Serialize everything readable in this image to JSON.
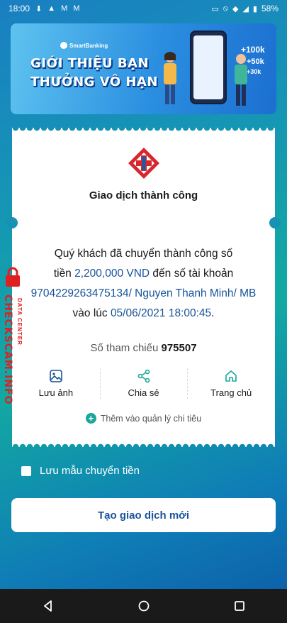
{
  "status_bar": {
    "time": "18:00",
    "battery": "58%"
  },
  "banner": {
    "brand": "SmartBanking",
    "headline_line1": "GIỚI THIỆU BẠN",
    "headline_line2": "THƯỞNG VÔ HẠN",
    "bonus_1": "+100k",
    "bonus_2": "+50k",
    "bonus_3": "+30k"
  },
  "receipt": {
    "title": "Giao dịch thành công",
    "msg_line1": "Quý khách đã chuyển thành công số",
    "msg_prefix2": "tiền ",
    "amount": "2,200,000 VND",
    "msg_mid2": " đến số tài khoản",
    "recipient": "9704229263475134/ Nguyen Thanh Minh/ MB",
    "msg_prefix4": "vào lúc ",
    "datetime": "05/06/2021 18:00:45",
    "msg_suffix4": ".",
    "ref_label": "Số tham chiếu",
    "ref_number": "975507",
    "actions": [
      {
        "label": "Lưu ảnh",
        "icon": "image-icon"
      },
      {
        "label": "Chia sẻ",
        "icon": "share-icon"
      },
      {
        "label": "Trang chủ",
        "icon": "home-icon"
      }
    ],
    "add_expense": "Thêm vào quản lý chi tiêu"
  },
  "save_template": {
    "label": "Lưu mẫu chuyển tiền",
    "checked": false
  },
  "new_transaction_button": "Tạo giao dịch mới",
  "watermark": {
    "main": "CHECKSCAM.INFO",
    "sub": "DATA CENTER"
  },
  "colors": {
    "accent": "#17539a",
    "teal": "#1aa69b",
    "logo_red": "#d7262d"
  }
}
